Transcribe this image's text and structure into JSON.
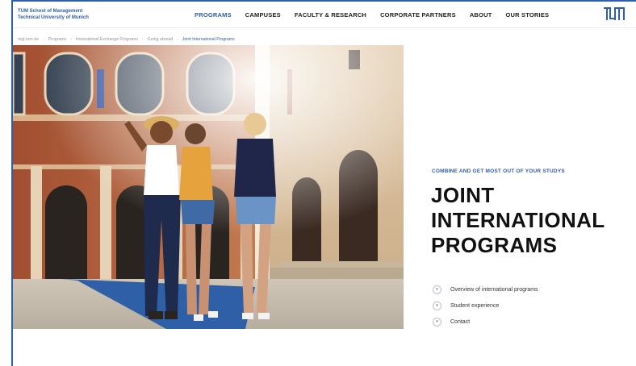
{
  "header": {
    "brand_line1": "TUM School of Management",
    "brand_line2": "Technical University of Munich",
    "logo_text": "TUM",
    "nav": [
      {
        "label": "PROGRAMS",
        "active": true
      },
      {
        "label": "CAMPUSES"
      },
      {
        "label": "FACULTY & RESEARCH"
      },
      {
        "label": "CORPORATE PARTNERS"
      },
      {
        "label": "ABOUT"
      },
      {
        "label": "OUR STORIES"
      }
    ]
  },
  "breadcrumb": [
    {
      "label": "mgt.tum.de"
    },
    {
      "label": "Programs"
    },
    {
      "label": "International Exchange Programs"
    },
    {
      "label": "Going abroad"
    },
    {
      "label": "Joint International Programs",
      "current": true
    }
  ],
  "hero": {
    "eyebrow": "COMBINE AND GET MOST OUT OF YOUR STUDYS",
    "title_lines": [
      "JOINT",
      "INTERNATIONAL",
      "PROGRAMS"
    ],
    "links": [
      {
        "label": "Overview of international programs",
        "icon": "chevron-down-icon"
      },
      {
        "label": "Student experience",
        "icon": "chevron-down-icon"
      },
      {
        "label": "Contact",
        "icon": "chevron-down-icon"
      }
    ]
  },
  "colors": {
    "brand_blue": "#2f5fa6",
    "text_dark": "#111111"
  }
}
